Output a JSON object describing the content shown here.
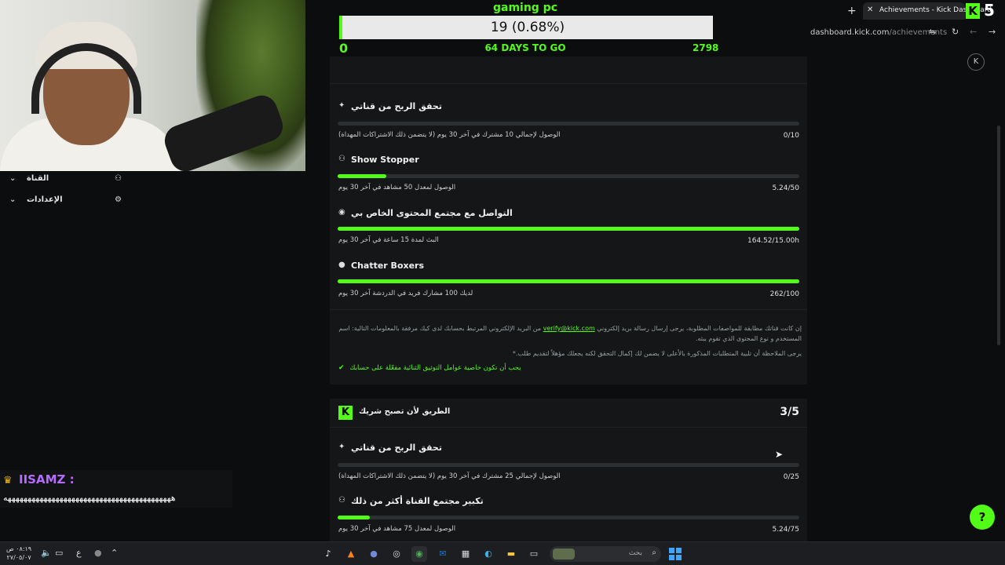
{
  "goal_overlay": {
    "title": "gaming pc",
    "progress_text": "19 (0.68%)",
    "progress_fraction": 0.0068,
    "start_value": "0",
    "days_left": "64 DAYS TO GO",
    "target_value": "2798"
  },
  "browser": {
    "tab_title": "Achievements - Kick Dashboard",
    "url_domain": "dashboard.kick.com",
    "url_path": "/achievements",
    "extension_count": "5"
  },
  "left_panel": {
    "items": [
      {
        "label": "القناة"
      },
      {
        "label": "الإعدادات"
      }
    ]
  },
  "chat": {
    "username": "IISAMZ",
    "separator": ":",
    "message": "ههههههههههههههههههههههههههههههههههههههههههه"
  },
  "achievements_top": {
    "rows": [
      {
        "title": "تحقق الربح من قناتي",
        "desc": "الوصول لإجمالي 10 مشترك في آخر 30 يوم (لا يتضمن ذلك الاشتراكات المهداة)",
        "value": "0/10",
        "progress": 0
      },
      {
        "title": "Show Stopper",
        "desc": "الوصول لمعدل 50 مشاهد في آخر 30 يوم",
        "value": "5.24/50",
        "progress": 0.105
      },
      {
        "title": "التواصل مع مجتمع المحتوى الخاص بي",
        "desc": "البث لمدة 15 ساعة في آخر 30 يوم",
        "value": "164.52/15.00h",
        "progress": 1
      },
      {
        "title": "Chatter Boxers",
        "desc": "لديك 100 مشارك فريد في الدردشة آخر 30 يوم",
        "value": "262/100",
        "progress": 1
      }
    ],
    "note_prefix": "إن كانت قناتك مطابقة للمواصفات المطلوبة، يرجى إرسال رسالة بريد إلكتروني",
    "note_email": "verify@kick.com",
    "note_suffix": "من البريد الإلكتروني المرتبط بحسابك لدى كيك مرفقة بالمعلومات التالية: اسم المستخدم و نوع المحتوى الذي تقوم ببثه.",
    "note_2": "يرجى الملاحظة أن تلبية المتطلبات المذكورة بالأعلى لا يضمن لك إكمال التحقق لكنه يجعلك مؤهلاً لتقديم طلب.*",
    "requirement": "يجب أن تكون خاصية عوامل التوثيق الثنائية مفعّلة على حسابك"
  },
  "partner_section": {
    "title": "الطريق لأن تصبح شريك",
    "count": "3/5",
    "rows": [
      {
        "title": "تحقق الربح من قناتي",
        "desc": "الوصول لإجمالي 25 مشترك في آخر 30 يوم (لا يتضمن ذلك الاشتراكات المهداة)",
        "value": "0/25",
        "progress": 0
      },
      {
        "title": "تكبير مجتمع القناة أكثر من ذلك",
        "desc": "الوصول لمعدل 75 مشاهد في آخر 30 يوم",
        "value": "5.24/75",
        "progress": 0.07
      }
    ]
  },
  "taskbar": {
    "time": "٠٨:١٩ ص",
    "date": "٢٧/٠٥/٠٧",
    "lang": "ع",
    "search_placeholder": "بحث"
  },
  "colors": {
    "accent": "#53fc18",
    "background": "#0b0d0e",
    "card": "#141617",
    "username": "#b46cff"
  }
}
